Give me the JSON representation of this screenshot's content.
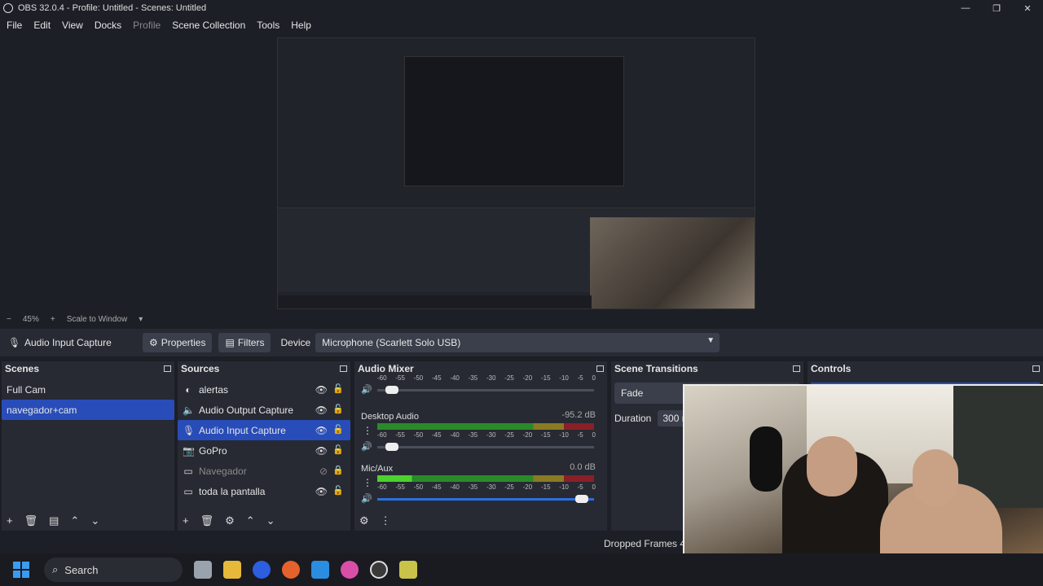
{
  "window": {
    "title": "OBS 32.0.4 - Profile: Untitled - Scenes: Untitled",
    "controls": [
      "—",
      "❐",
      "✕"
    ]
  },
  "menu": [
    "File",
    "Edit",
    "View",
    "Docks",
    "Profile",
    "Scene Collection",
    "Tools",
    "Help"
  ],
  "zoom": {
    "minus": "−",
    "value": "45%",
    "plus": "+",
    "mode": "Scale to Window"
  },
  "source_toolbar": {
    "source_name": "Audio Input Capture",
    "properties": "Properties",
    "filters": "Filters",
    "device_label": "Device",
    "device_value": "Microphone (Scarlett Solo USB)"
  },
  "scenes": {
    "title": "Scenes",
    "items": [
      "Full Cam",
      "navegador+cam"
    ],
    "selected_index": 1
  },
  "sources": {
    "title": "Sources",
    "items": [
      {
        "name": "alertas",
        "icon": "browser-icon",
        "visible": true
      },
      {
        "name": "Audio Output Capture",
        "icon": "speaker-icon",
        "visible": true
      },
      {
        "name": "Audio Input Capture",
        "icon": "microphone-icon",
        "visible": true
      },
      {
        "name": "GoPro",
        "icon": "camera-icon",
        "visible": true
      },
      {
        "name": "Navegador",
        "icon": "window-icon",
        "visible": false
      },
      {
        "name": "toda la pantalla",
        "icon": "monitor-icon",
        "visible": true
      }
    ],
    "selected_index": 2
  },
  "audio_mixer": {
    "title": "Audio Mixer",
    "scale": [
      "-60",
      "-55",
      "-50",
      "-45",
      "-40",
      "-35",
      "-30",
      "-25",
      "-20",
      "-15",
      "-10",
      "-5",
      "0"
    ],
    "channels": [
      {
        "name": "",
        "db": "",
        "fader_level": 0.04
      },
      {
        "name": "Desktop Audio",
        "db": "-95.2 dB",
        "fader_level": 0.04
      },
      {
        "name": "Mic/Aux",
        "db": "0.0 dB",
        "fader_level": 0.97
      }
    ]
  },
  "scene_transitions": {
    "title": "Scene Transitions",
    "transition": "Fade",
    "duration_label": "Duration",
    "duration_value": "300 r"
  },
  "controls": {
    "title": "Controls"
  },
  "status": {
    "dropped_frames": "Dropped Frames 4C"
  },
  "taskbar": {
    "search": "Search"
  },
  "colors": {
    "background": "#1d1f26",
    "dock": "#272a33",
    "selection": "#284cb8",
    "meter_green": "#4cd12e",
    "meter_red": "#8a1f28"
  }
}
